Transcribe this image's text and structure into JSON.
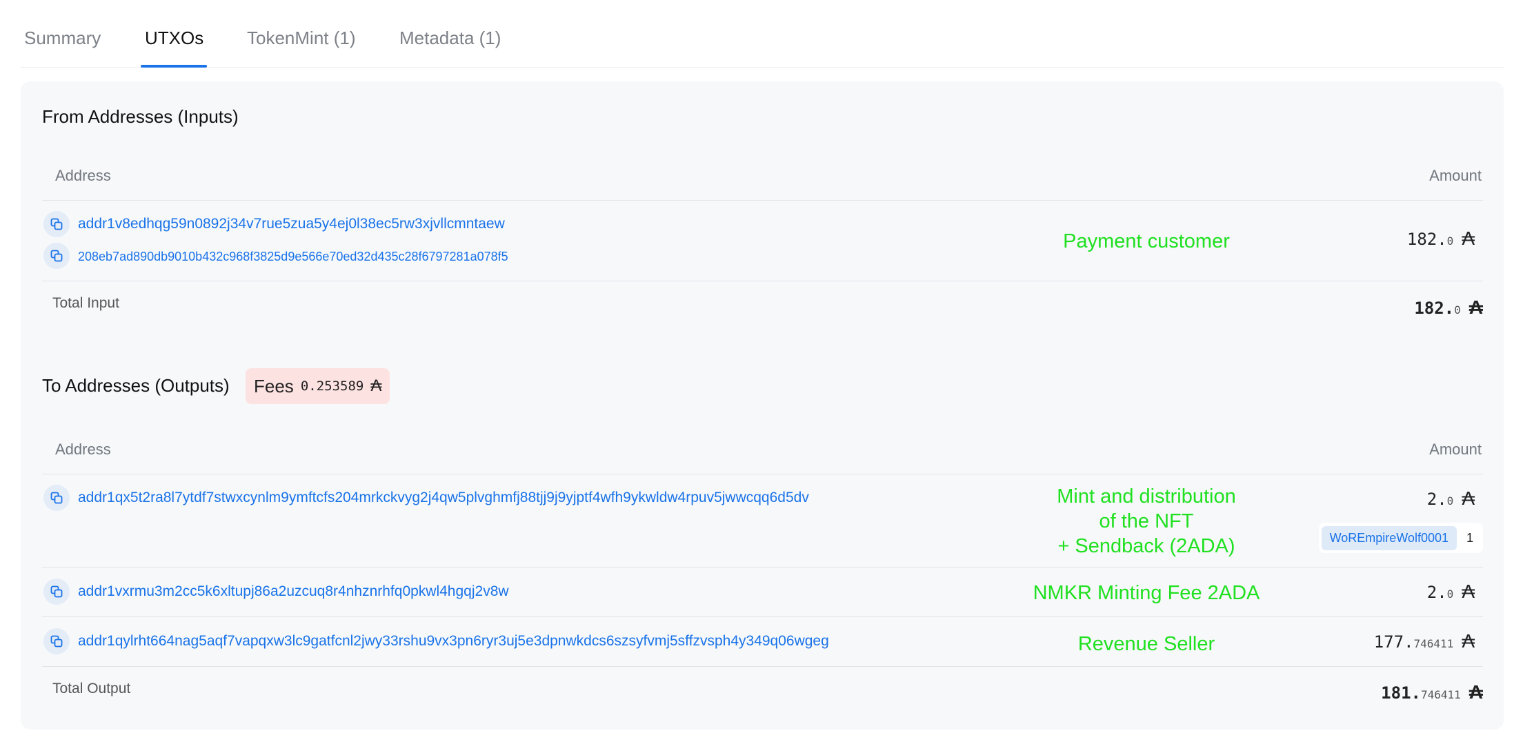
{
  "tabs": [
    {
      "label": "Summary"
    },
    {
      "label": "UTXOs"
    },
    {
      "label": "TokenMint (1)"
    },
    {
      "label": "Metadata (1)"
    }
  ],
  "active_tab": "UTXOs",
  "inputs": {
    "title": "From Addresses (Inputs)",
    "col_address": "Address",
    "col_amount": "Amount",
    "row": {
      "address": "addr1v8edhqg59n0892j34v7rue5zua5y4ej0l38ec5rw3xjvllcmntaew",
      "tx_hash": "208eb7ad890db9010b432c968f3825d9e566e70ed32d435c28f6797281a078f5",
      "note": "Payment customer",
      "amount_int": "182.",
      "amount_dec": "0"
    },
    "total_label": "Total Input",
    "total_int": "182.",
    "total_dec": "0"
  },
  "outputs": {
    "title": "To Addresses (Outputs)",
    "fees_label": "Fees",
    "fees_value": "0.253589",
    "col_address": "Address",
    "col_amount": "Amount",
    "rows": [
      {
        "address": "addr1qx5t2ra8l7ytdf7stwxcynlm9ymftcfs204mrkckvyg2j4qw5plvghmfj88tjj9j9yjptf4wfh9ykwldw4rpuv5jwwcqq6d5dv",
        "note_lines": [
          "Mint and distribution",
          "of the NFT",
          "+ Sendback (2ADA)"
        ],
        "amount_int": "2.",
        "amount_dec": "0",
        "token_name": "WoREmpireWolf0001",
        "token_qty": "1"
      },
      {
        "address": "addr1vxrmu3m2cc5k6xltupj86a2uzcuq8r4nhznrhfq0pkwl4hgqj2v8w",
        "note": "NMKR Minting Fee 2ADA",
        "amount_int": "2.",
        "amount_dec": "0"
      },
      {
        "address": "addr1qylrht664nag5aqf7vapqxw3lc9gatfcnl2jwy33rshu9vx3pn6ryr3uj5e3dpnwkdcs6szsyfvmj5sffzvsph4y349q06wgeg",
        "note": "Revenue Seller",
        "amount_int": "177.",
        "amount_dec": "746411"
      }
    ],
    "total_label": "Total Output",
    "total_int": "181.",
    "total_dec": "746411"
  },
  "ada_symbol": "₳",
  "colors": {
    "link": "#1a73e8",
    "annotation": "#20e020",
    "fees_bg": "#fde2e2",
    "panel_bg": "#f6f8fa"
  }
}
